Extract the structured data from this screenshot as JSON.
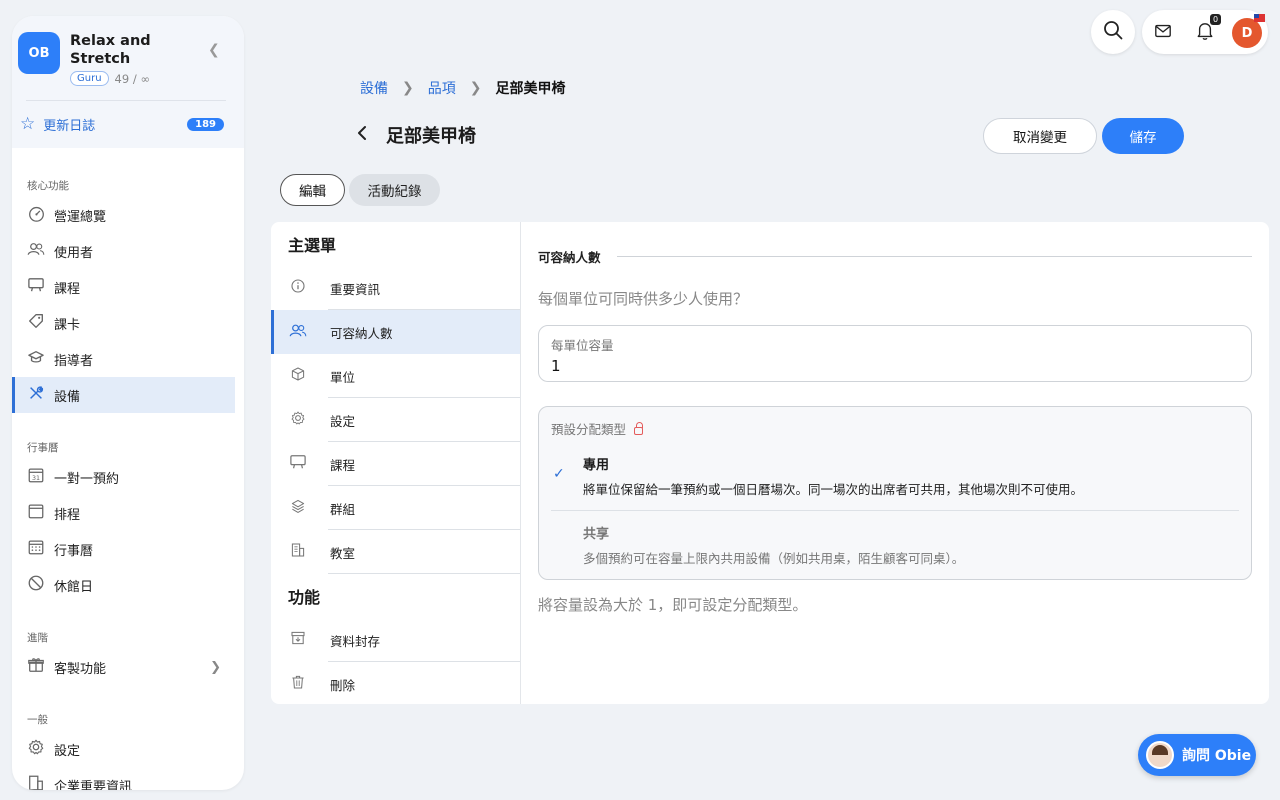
{
  "brand": {
    "logo_text": "OB",
    "name": "Relax and Stretch",
    "tier": "Guru",
    "count": "49 / ∞"
  },
  "sidebar": {
    "changelog": {
      "label": "更新日誌",
      "badge": "189"
    },
    "sections": [
      {
        "title": "核心功能",
        "items": [
          {
            "label": "營運總覽",
            "icon": "dashboard-icon"
          },
          {
            "label": "使用者",
            "icon": "users-icon"
          },
          {
            "label": "課程",
            "icon": "class-icon"
          },
          {
            "label": "課卡",
            "icon": "tag-icon"
          },
          {
            "label": "指導者",
            "icon": "instructor-icon"
          },
          {
            "label": "設備",
            "icon": "tools-icon",
            "active": true
          }
        ]
      },
      {
        "title": "行事曆",
        "items": [
          {
            "label": "一對一預約",
            "icon": "calendar-31-icon"
          },
          {
            "label": "排程",
            "icon": "calendar-icon"
          },
          {
            "label": "行事曆",
            "icon": "calendar-grid-icon"
          },
          {
            "label": "休館日",
            "icon": "closed-icon"
          }
        ]
      },
      {
        "title": "進階",
        "items": [
          {
            "label": "客製功能",
            "icon": "gift-icon"
          }
        ]
      },
      {
        "title": "一般",
        "items": [
          {
            "label": "設定",
            "icon": "gear-icon"
          },
          {
            "label": "企業重要資訊",
            "icon": "building-icon"
          }
        ]
      }
    ]
  },
  "topbar": {
    "notification_count": "0",
    "avatar_initial": "D"
  },
  "breadcrumb": {
    "item1": "設備",
    "item2": "品項",
    "current": "足部美甲椅"
  },
  "page": {
    "title": "足部美甲椅",
    "cancel_label": "取消變更",
    "save_label": "儲存"
  },
  "tabs": {
    "edit": "編輯",
    "activity": "活動紀錄"
  },
  "menu": {
    "main_heading": "主選單",
    "main_items": [
      {
        "label": "重要資訊",
        "icon": "info-icon"
      },
      {
        "label": "可容納人數",
        "icon": "people-icon",
        "active": true
      },
      {
        "label": "單位",
        "icon": "box-icon"
      },
      {
        "label": "設定",
        "icon": "gear-icon"
      },
      {
        "label": "課程",
        "icon": "class-icon"
      },
      {
        "label": "群組",
        "icon": "layers-icon"
      },
      {
        "label": "教室",
        "icon": "building-icon"
      }
    ],
    "func_heading": "功能",
    "func_items": [
      {
        "label": "資料封存",
        "icon": "archive-icon"
      },
      {
        "label": "刪除",
        "icon": "trash-icon"
      }
    ]
  },
  "capacity": {
    "section_title": "可容納人數",
    "question": "每個單位可同時供多少人使用？",
    "field_label": "每單位容量",
    "field_value": "1",
    "alloc_label": "預設分配類型",
    "option1_title": "專用",
    "option1_desc": "將單位保留給一筆預約或一個日曆場次。同一場次的出席者可共用，其他場次則不可使用。",
    "option2_title": "共享",
    "option2_desc": "多個預約可在容量上限內共用設備（例如共用桌，陌生顧客可同桌）。",
    "hint": "將容量設為大於 1，即可設定分配類型。"
  },
  "assistant": {
    "label": "詢問 Obie"
  },
  "colors": {
    "accent": "#2d7ff9",
    "active_bg": "#e3ecf9",
    "avatar": "#e4572e"
  }
}
